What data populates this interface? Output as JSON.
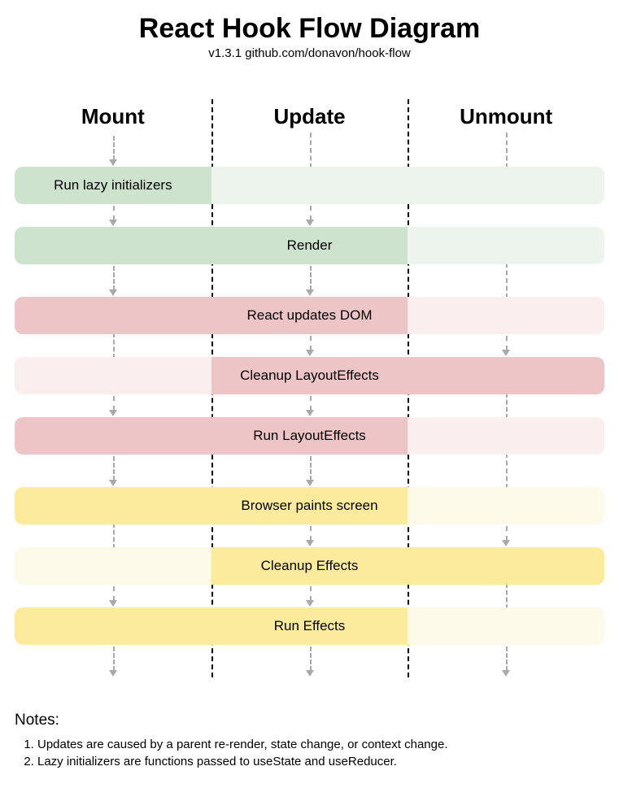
{
  "title": "React Hook Flow Diagram",
  "subtitle": "v1.3.1 github.com/donavon/hook-flow",
  "columns": {
    "mount": "Mount",
    "update": "Update",
    "unmount": "Unmount"
  },
  "stages": {
    "lazy_init": "Run lazy initializers",
    "render": "Render",
    "update_dom": "React updates DOM",
    "cleanup_layout": "Cleanup LayoutEffects",
    "run_layout": "Run LayoutEffects",
    "paint": "Browser paints screen",
    "cleanup_effects": "Cleanup Effects",
    "run_effects": "Run Effects"
  },
  "notes_title": "Notes:",
  "notes": {
    "n1": "Updates are caused by a parent re-render, state change, or context change.",
    "n2": "Lazy initializers are functions passed to useState and useReducer."
  },
  "colors": {
    "green_strong": "#cee3ce",
    "green_faint": "#edf4ed",
    "red_strong": "#eec5c6",
    "red_faint": "#fbeeef",
    "yellow_strong": "#fdeb9d",
    "yellow_faint": "#fefaea"
  }
}
